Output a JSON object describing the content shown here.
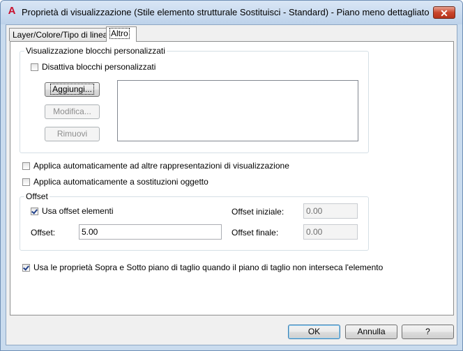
{
  "window": {
    "title": "Proprietà di visualizzazione (Stile elemento strutturale Sostituisci - Standard) - Piano meno dettagliato",
    "close_glyph": "✕"
  },
  "tabs": [
    {
      "label": "Layer/Colore/Tipo di linea",
      "active": false
    },
    {
      "label": "Altro",
      "active": true
    }
  ],
  "custom_blocks": {
    "legend": "Visualizzazione blocchi personalizzati",
    "disable_label": "Disattiva blocchi personalizzati",
    "disable_checked": false,
    "add_label": "Aggiungi...",
    "edit_label": "Modifica...",
    "remove_label": "Rimuovi"
  },
  "options": {
    "apply_other_label": "Applica automaticamente ad altre rappresentazioni di visualizzazione",
    "apply_other_checked": false,
    "apply_override_label": "Applica automaticamente a sostituzioni oggetto",
    "apply_override_checked": false
  },
  "offset": {
    "legend": "Offset",
    "use_label": "Usa offset elementi",
    "use_checked": true,
    "offset_label": "Offset:",
    "offset_value": "5.00",
    "start_label": "Offset iniziale:",
    "start_value": "0.00",
    "end_label": "Offset finale:",
    "end_value": "0.00"
  },
  "cut_plane": {
    "label": "Usa le proprietà Sopra e Sotto piano di taglio quando il piano di taglio non interseca l'elemento",
    "checked": true
  },
  "footer": {
    "ok_label": "OK",
    "cancel_label": "Annulla",
    "help_label": "?"
  }
}
